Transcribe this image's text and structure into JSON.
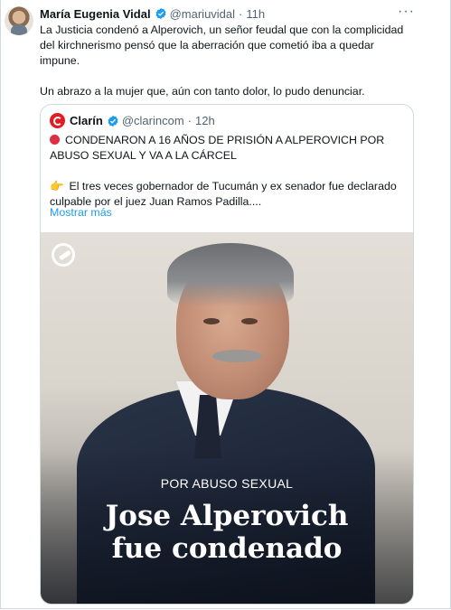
{
  "tweet": {
    "author_name": "María Eugenia Vidal",
    "handle": "@mariuvidal",
    "time": "11h",
    "more_icon": "···",
    "text": "La Justicia condenó a Alperovich, un señor feudal que con la complicidad del kirchnerismo pensó que la aberración que cometió iba a quedar impune.\n\nUn abrazo a la mujer que, aún con tanto dolor, lo pudo denunciar."
  },
  "quote": {
    "author_name": "Clarín",
    "handle": "@clarincom",
    "time": "12h",
    "line1": "CONDENARON A 16 AÑOS DE PRISIÓN A ALPEROVICH POR ABUSO SEXUAL Y VA A LA CÁRCEL",
    "line2": "El tres veces gobernador de Tucumán y ex senador fue declarado culpable por el juez Juan Ramos Padilla....",
    "hand_icon": "👉",
    "show_more": "Mostrar más",
    "media": {
      "kicker": "POR ABUSO SEXUAL",
      "headline_1": "Jose Alperovich",
      "headline_2": "fue condenado"
    }
  },
  "colors": {
    "link": "#1d9bf0",
    "verified": "#1d9bf0",
    "clarin_red": "#e31b23",
    "muted": "#536471"
  }
}
